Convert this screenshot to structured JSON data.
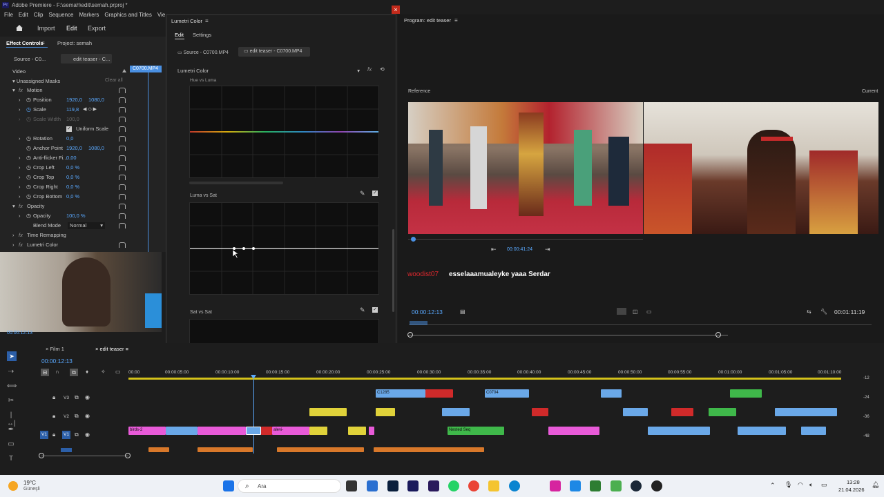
{
  "window": {
    "title": "Adobe Premiere - F:\\semah\\edit\\semah.prproj *",
    "app_logo": "Pr"
  },
  "menu": [
    "File",
    "Edit",
    "Clip",
    "Sequence",
    "Markers",
    "Graphics and Titles",
    "Vie"
  ],
  "workspace": {
    "items": [
      "Import",
      "Edit",
      "Export"
    ],
    "active": "Edit"
  },
  "effect_controls": {
    "tab_effect_controls": "Effect Controls",
    "tab_project": "Project: semah",
    "source_label": "Source - C0...",
    "sequence_label": "edit teaser - C...",
    "clip_chip": "C0700.MP4",
    "video_heading": "Video",
    "unassigned_masks": "Unassigned Masks",
    "clear_all": "Clear all",
    "rows": [
      {
        "label": "Motion",
        "value": "",
        "value2": ""
      },
      {
        "label": "Position",
        "value": "1920,0",
        "value2": "1080,0"
      },
      {
        "label": "Scale",
        "value": "119,8",
        "value2": ""
      },
      {
        "label": "Scale Width",
        "value": "100,0",
        "value2": ""
      },
      {
        "label": "Uniform Scale",
        "value": "",
        "value2": ""
      },
      {
        "label": "Rotation",
        "value": "0,0",
        "value2": ""
      },
      {
        "label": "Anchor Point",
        "value": "1920,0",
        "value2": "1080,0"
      },
      {
        "label": "Anti-flicker Fi...",
        "value": "0,00",
        "value2": ""
      },
      {
        "label": "Crop Left",
        "value": "0,0 %",
        "value2": ""
      },
      {
        "label": "Crop Top",
        "value": "0,0 %",
        "value2": ""
      },
      {
        "label": "Crop Right",
        "value": "0,0 %",
        "value2": ""
      },
      {
        "label": "Crop Bottom",
        "value": "0,0 %",
        "value2": ""
      },
      {
        "label": "Opacity",
        "value": "",
        "value2": ""
      },
      {
        "label": "Opacity",
        "value": "100,0 %",
        "value2": ""
      },
      {
        "label": "Blend Mode",
        "value": "Normal",
        "value2": ""
      },
      {
        "label": "Time Remapping",
        "value": "",
        "value2": ""
      },
      {
        "label": "Lumetri Color",
        "value": "",
        "value2": ""
      }
    ],
    "timecode": "00:00:12:13"
  },
  "lumetri": {
    "title": "Lumetri Color",
    "tabs": [
      "Edit",
      "Settings"
    ],
    "source_label": "Source - C0700.MP4",
    "sequence_label": "edit teaser - C0700.MP4",
    "effect_dropdown": "Lumetri Color",
    "section_hue_luma": "Hue vs Luma",
    "section_luma_sat": "Luma vs Sat",
    "section_sat_sat": "Sat vs Sat"
  },
  "program": {
    "title": "Program: edit teaser",
    "reference_label": "Reference",
    "current_label": "Current",
    "ref_timecode": "00:00:41:24",
    "chat_user": "woodist07",
    "chat_message": "esselaaamualeyke yaaa Serdar",
    "timecode": "00:00:12:13",
    "duration": "00:01:11:19"
  },
  "timeline": {
    "tabs": [
      "Film 1",
      "edit teaser"
    ],
    "timecode": "00:00:12:13",
    "ruler": [
      "00:00",
      "00:00:05:00",
      "00:00:10:00",
      "00:00:15:00",
      "00:00:20:00",
      "00:00:25:00",
      "00:00:30:00",
      "00:00:35:00",
      "00:00:40:00",
      "00:00:45:00",
      "00:00:50:00",
      "00:00:55:00",
      "00:01:00:00",
      "00:01:05:00",
      "00:01:10:00"
    ],
    "tracks": [
      "V3",
      "V2",
      "V1"
    ],
    "v1_source_label": "V1",
    "clip_labels": [
      "C1285",
      "C0704",
      "birds-2",
      "alevi-",
      "Nested Seq"
    ],
    "meter_labels": [
      "-12",
      "-24",
      "-36",
      "-48"
    ]
  },
  "taskbar": {
    "weather_temp": "19°C",
    "weather_desc": "Güneşli",
    "search": "Ara",
    "time": "13:28",
    "date": "21.04.2026"
  },
  "colors": {
    "accent": "#4a90e2",
    "timecode": "#5aa9ff",
    "chat_user": "#e0282e"
  }
}
